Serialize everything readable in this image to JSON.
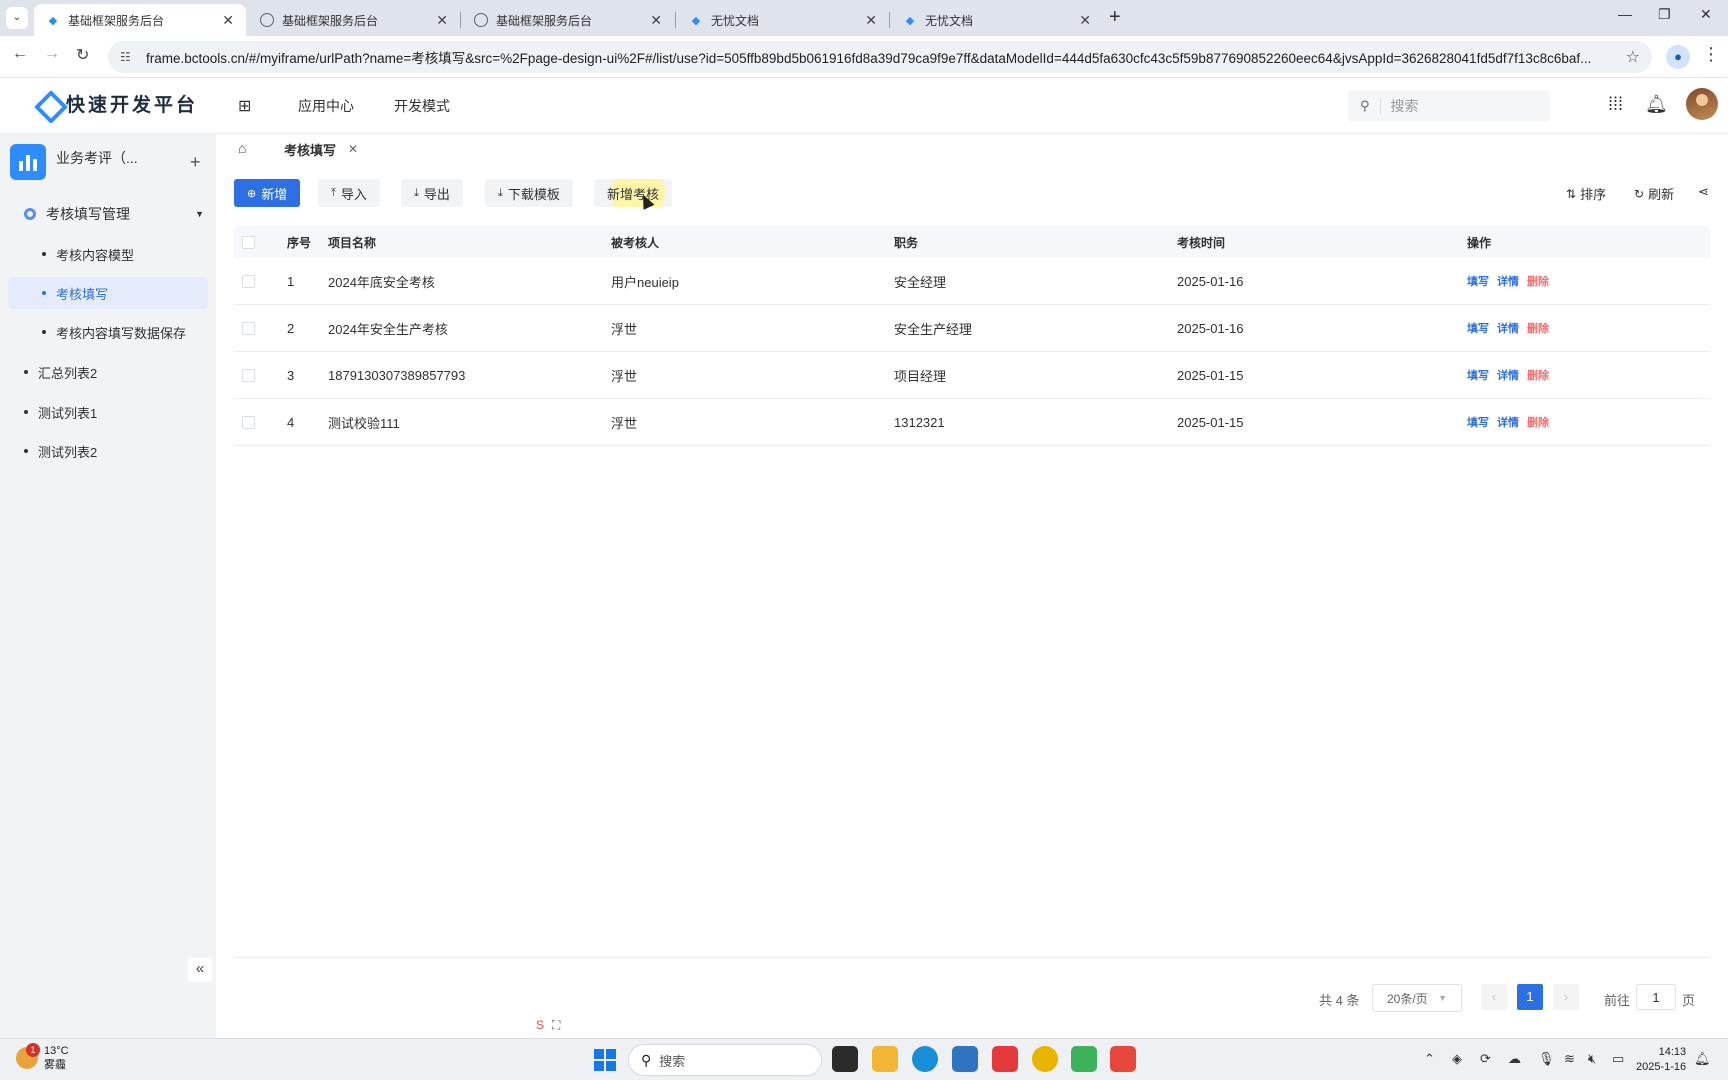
{
  "browser": {
    "tabs": [
      {
        "title": "基础框架服务后台",
        "active": true
      },
      {
        "title": "基础框架服务后台",
        "active": false
      },
      {
        "title": "基础框架服务后台",
        "active": false
      },
      {
        "title": "无忧文档",
        "active": false
      },
      {
        "title": "无忧文档",
        "active": false
      }
    ],
    "url": "frame.bctools.cn/#/myiframe/urlPath?name=考核填写&src=%2Fpage-design-ui%2F#/list/use?id=505ffb89bd5b061916fd8a39d79ca9f9e7ff&dataModelId=444d5fa630cfc43c5f59b877690852260eec64&jvsAppId=3626828041fd5df7f13c8c6baf..."
  },
  "header": {
    "logo_text": "快速开发平台",
    "menu": [
      "应用中心",
      "开发模式"
    ],
    "search_placeholder": "搜索"
  },
  "sidebar": {
    "app_name": "业务考评（...",
    "group": "考核填写管理",
    "items": [
      "考核内容模型",
      "考核填写",
      "考核内容填写数据保存"
    ],
    "top_items": [
      "汇总列表2",
      "测试列表1",
      "测试列表2"
    ],
    "collapse": "«"
  },
  "page_tab": "考核填写",
  "toolbar": {
    "add": "新增",
    "import": "导入",
    "export": "导出",
    "download_template": "下载模板",
    "add_review": "新增考核",
    "sort": "排序",
    "refresh": "刷新"
  },
  "table": {
    "columns": [
      "序号",
      "项目名称",
      "被考核人",
      "职务",
      "考核时间",
      "操作"
    ],
    "rows": [
      {
        "no": "1",
        "name": "2024年底安全考核",
        "person": "用户neuieip",
        "title": "安全经理",
        "date": "2025-01-16"
      },
      {
        "no": "2",
        "name": "2024年安全生产考核",
        "person": "浮世",
        "title": "安全生产经理",
        "date": "2025-01-16"
      },
      {
        "no": "3",
        "name": "1879130307389857793",
        "person": "浮世",
        "title": "项目经理",
        "date": "2025-01-15"
      },
      {
        "no": "4",
        "name": "测试校验111",
        "person": "浮世",
        "title": "1312321",
        "date": "2025-01-15"
      }
    ],
    "actions": {
      "fill": "填写",
      "detail": "详情",
      "delete": "删除"
    }
  },
  "pagination": {
    "total": "共 4 条",
    "page_size": "20条/页",
    "current": "1",
    "goto_prefix": "前往",
    "goto_value": "1",
    "goto_suffix": "页"
  },
  "taskbar": {
    "weather_temp": "13°C",
    "weather_desc": "雾霾",
    "weather_badge": "1",
    "search": "搜索",
    "time": "14:13",
    "date": "2025-1-16"
  },
  "colors": {
    "primary": "#2f6fe4",
    "danger": "#f56c6c",
    "sidebar_bg": "#f2f3f5"
  }
}
